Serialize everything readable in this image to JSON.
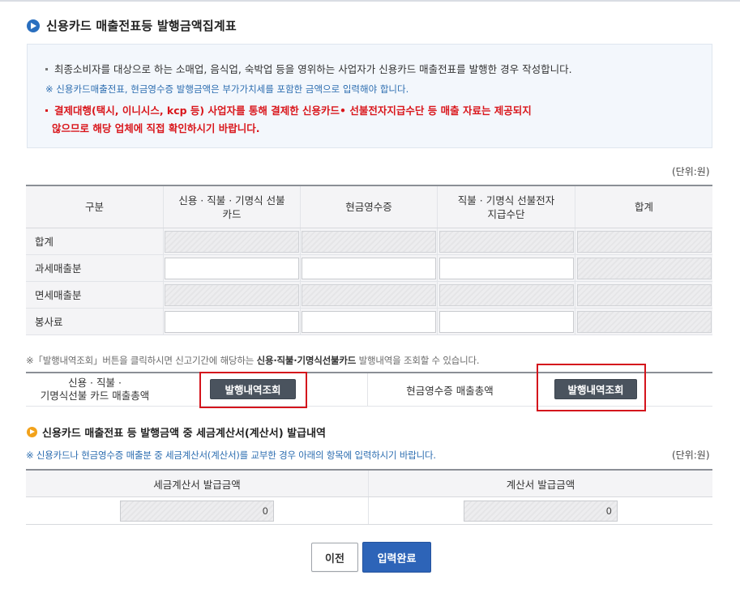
{
  "section1": {
    "title": "신용카드 매출전표등 발행금액집계표"
  },
  "info": {
    "line1": "최종소비자를 대상으로 하는 소매업, 음식업, 숙박업 등을 영위하는 사업자가 신용카드 매출전표를 발행한 경우 작성합니다.",
    "line2": "※ 신용카드매출전표, 현금영수증 발행금액은 부가가치세를 포함한 금액으로 입력해야 합니다.",
    "line3a": "결제대행(택시, 이니시스, kcp 등) 사업자를 통해 결제한 신용카드• 선불전자지급수단 등 매출 자료는 제공되지",
    "line3b": "않으므로 해당 업체에 직접 확인하시기 바랍니다."
  },
  "unit_label": "(단위:원)",
  "table": {
    "headers": [
      "구분",
      "신용 · 직불 · 기명식 선불카드",
      "현금영수증",
      "직불 · 기명식 선불전자지급수단",
      "합계"
    ],
    "rows": [
      {
        "label": "합계",
        "editable": [
          false,
          false,
          false,
          false
        ]
      },
      {
        "label": "과세매출분",
        "editable": [
          true,
          true,
          true,
          false
        ]
      },
      {
        "label": "면세매출분",
        "editable": [
          false,
          false,
          false,
          false
        ]
      },
      {
        "label": "봉사료",
        "editable": [
          true,
          true,
          true,
          false
        ]
      }
    ]
  },
  "note1": {
    "prefix": "※「발행내역조회」버튼을 클릭하시면 신고기간에 해당하는 ",
    "bold": "신용·직불·기명식선불카드",
    "suffix": " 발행내역을 조회할 수 있습니다."
  },
  "summary": {
    "card_label_line1": "신용 · 직불 ·",
    "card_label_line2": "기명식선불 카드 매출총액",
    "card_button": "발행내역조회",
    "cash_label": "현금영수증 매출총액",
    "cash_button": "발행내역조회"
  },
  "section2": {
    "title": "신용카드 매출전표 등 발행금액 중 세금계산서(계산서) 발급내역",
    "note": "※ 신용카드나 현금영수증 매출분 중 세금계산서(계산서)를 교부한 경우 아래의 항목에 입력하시기 바랍니다."
  },
  "table2": {
    "headers": [
      "세금계산서 발급금액",
      "계산서 발급금액"
    ],
    "values": [
      "0",
      "0"
    ]
  },
  "buttons": {
    "prev": "이전",
    "done": "입력완료"
  },
  "colors": {
    "accent": "#2d64b8",
    "warning": "#d9171c",
    "highlight_box": "#d4141c"
  }
}
